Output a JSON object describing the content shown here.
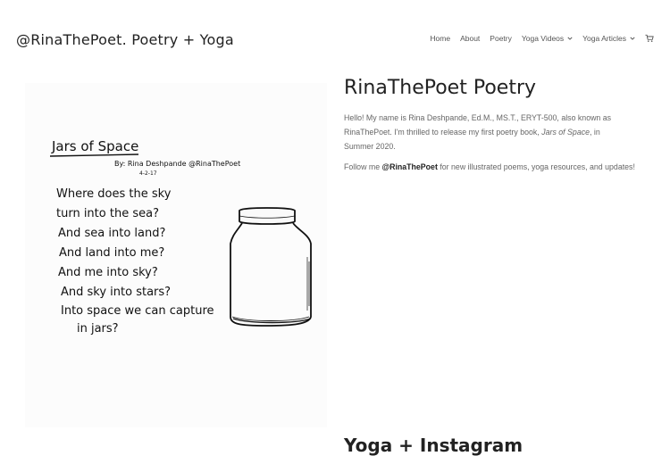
{
  "header": {
    "site_title": "@RinaThePoet.  Poetry + Yoga",
    "nav": [
      {
        "label": "Home",
        "dropdown": false
      },
      {
        "label": "About",
        "dropdown": false
      },
      {
        "label": "Poetry",
        "dropdown": false
      },
      {
        "label": "Yoga Videos",
        "dropdown": true
      },
      {
        "label": "Yoga Articles",
        "dropdown": true
      }
    ],
    "cart_icon": "cart-icon"
  },
  "poem_image": {
    "title": "Jars of Space",
    "byline": "By: Rina Deshpande @RinaThePoet",
    "date": "4-2-17",
    "lines": [
      "Where does the sky",
      "turn into the sea?",
      "And sea into land?",
      "And land into me?",
      "And me into sky?",
      "And sky into stars?",
      "Into space we can capture",
      "in jars?"
    ]
  },
  "main": {
    "title": "RinaThePoet Poetry",
    "intro_before": "Hello! My name is Rina Deshpande, Ed.M., MS.T., ERYT-500, also known as RinaThePoet. I'm thrilled to release my first poetry book, ",
    "book_title": "Jars of Space",
    "intro_after": ", in Summer 2020.",
    "follow_before": "Follow me ",
    "follow_handle": "@RinaThePoet",
    "follow_after": " for new illustrated poems, yoga resources, and updates!",
    "next_heading": "Yoga + Instagram"
  }
}
